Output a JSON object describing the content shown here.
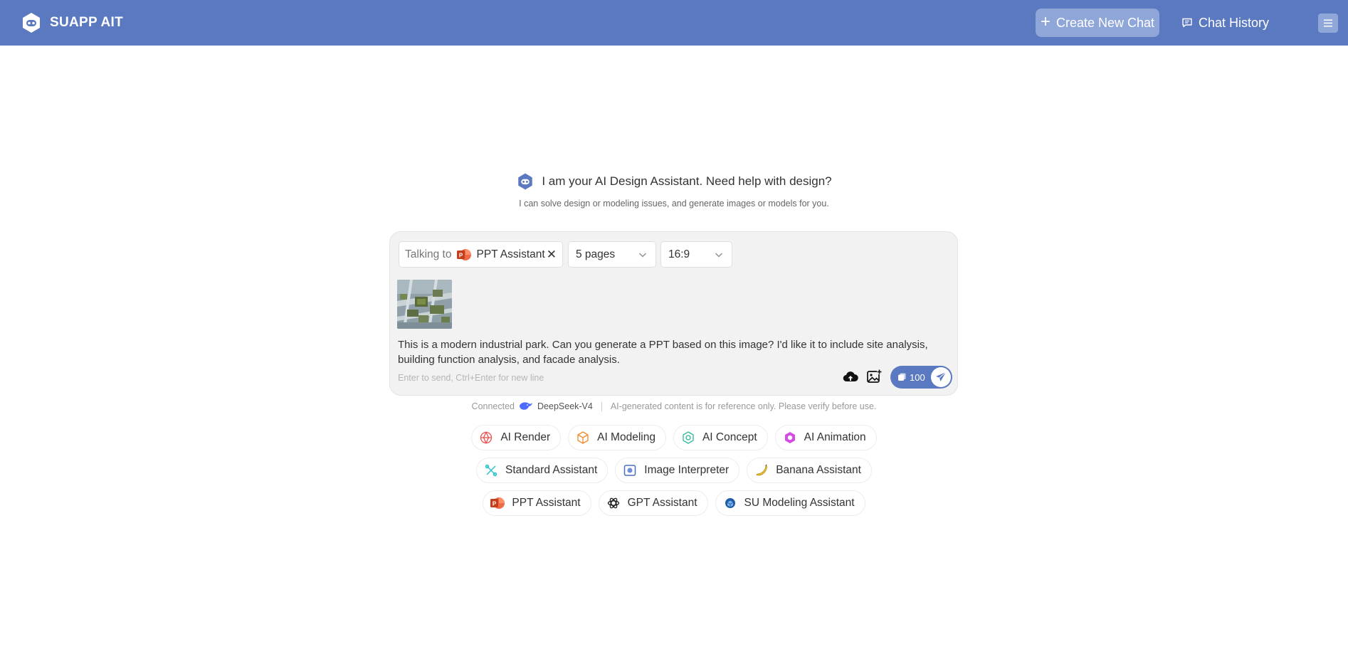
{
  "header": {
    "brand": "SUAPP AIT",
    "create_label": "Create New Chat",
    "history_label": "Chat History"
  },
  "greeting": {
    "title": "I am your AI Design Assistant. Need help with design?",
    "subtitle": "I can solve design or modeling issues, and generate images or models for you."
  },
  "composer": {
    "talking_label": "Talking to",
    "assistant": "PPT Assistant",
    "pages": "5 pages",
    "ratio": "16:9",
    "message": "This is a modern industrial park. Can you generate a PPT based on this image? I'd like it to include site analysis, building function analysis, and facade analysis.",
    "hint": "Enter to send, Ctrl+Enter for new line",
    "credits": "100"
  },
  "connection": {
    "connected": "Connected",
    "model": "DeepSeek-V4",
    "disclaimer": "AI-generated content is for reference only. Please verify before use."
  },
  "assistants": {
    "row1": [
      {
        "label": "AI Render",
        "icon": "render-icon"
      },
      {
        "label": "AI Modeling",
        "icon": "modeling-icon"
      },
      {
        "label": "AI Concept",
        "icon": "concept-icon"
      },
      {
        "label": "AI Animation",
        "icon": "animation-icon"
      }
    ],
    "row2": [
      {
        "label": "Standard Assistant",
        "icon": "standard-icon"
      },
      {
        "label": "Image Interpreter",
        "icon": "image-interpreter-icon"
      },
      {
        "label": "Banana Assistant",
        "icon": "banana-icon"
      }
    ],
    "row3": [
      {
        "label": "PPT Assistant",
        "icon": "ppt-icon"
      },
      {
        "label": "GPT Assistant",
        "icon": "gpt-icon"
      },
      {
        "label": "SU Modeling Assistant",
        "icon": "su-icon"
      }
    ]
  },
  "colors": {
    "header_bg": "#5b79c0",
    "accent": "#5b79c0",
    "button_light": "#8fa6d8"
  }
}
